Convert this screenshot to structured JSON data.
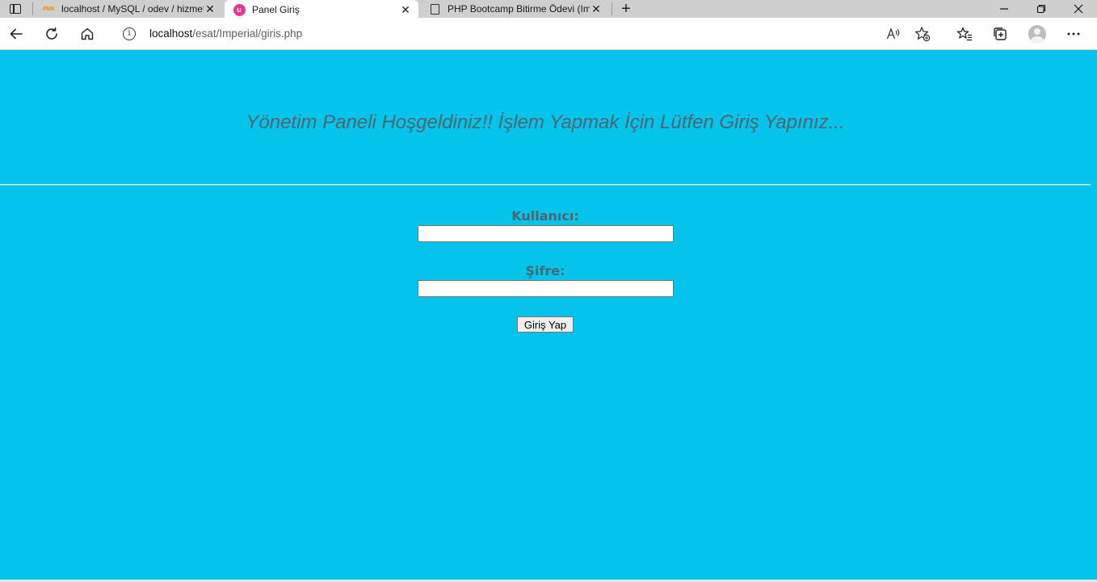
{
  "browser": {
    "tabs": [
      {
        "title": "localhost / MySQL / odev / hizmetler",
        "favicon": "phpmyadmin-icon",
        "active": false
      },
      {
        "title": "Panel Giriş",
        "favicon": "panel-app-icon",
        "active": true
      },
      {
        "title": "PHP Bootcamp Bitirme Ödevi (Imperial)",
        "favicon": "document-icon",
        "active": false
      }
    ],
    "favicon_pma_text": "PMA",
    "favicon_panel_text": "u",
    "address": {
      "host": "localhost",
      "path": "/esat/Imperial/giris.php"
    },
    "colors": {
      "tabstrip": "#cfcfcf",
      "panel_favicon": "#e5388f"
    }
  },
  "page": {
    "background": "#04c4ec",
    "heading": "Yönetim Paneli Hoşgeldiniz!! İşlem Yapmak İçin Lütfen Giriş Yapınız...",
    "form": {
      "username_label": "Kullanıcı:",
      "username_value": "",
      "password_label": "Şifre:",
      "password_value": "",
      "submit_label": "Giriş Yap"
    }
  }
}
